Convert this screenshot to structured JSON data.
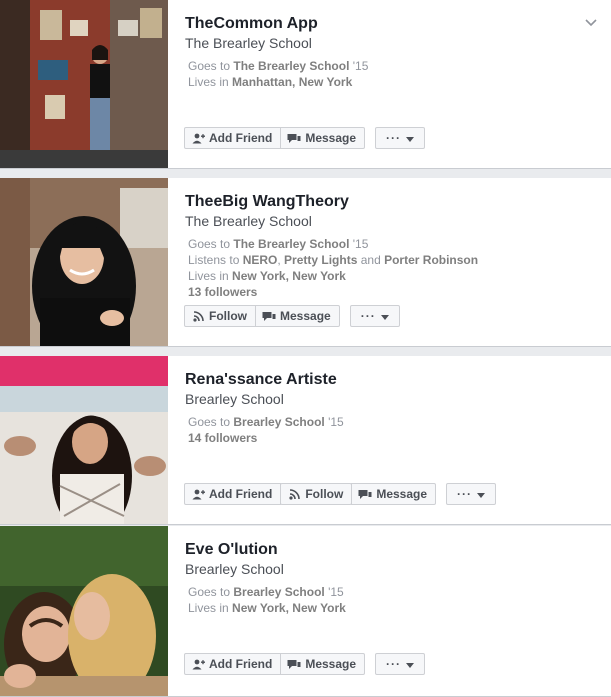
{
  "results": [
    {
      "name": "TheCommon App",
      "school": "The Brearley School",
      "goes_prefix": "Goes to ",
      "goes_school": "The Brearley School",
      "goes_year": " '15",
      "lives_prefix": "Lives in ",
      "lives_place": "Manhattan, New York",
      "add_friend": "Add Friend",
      "message": "Message",
      "more": "···"
    },
    {
      "name": "TheeBig WangTheory",
      "school": "The Brearley School",
      "goes_prefix": "Goes to ",
      "goes_school": "The Brearley School",
      "goes_year": " '15",
      "listens_prefix": "Listens to ",
      "artist1": "NERO",
      "sep1": ", ",
      "artist2": "Pretty Lights",
      "sep2": " and ",
      "artist3": "Porter Robinson",
      "lives_prefix": "Lives in ",
      "lives_place": "New York, New York",
      "followers": "13 followers",
      "follow": "Follow",
      "message": "Message",
      "more": "···"
    },
    {
      "name": "Rena'ssance Artiste",
      "school": "Brearley School",
      "goes_prefix": "Goes to ",
      "goes_school": "Brearley School",
      "goes_year": " '15",
      "followers": "14 followers",
      "add_friend": "Add Friend",
      "follow": "Follow",
      "message": "Message",
      "more": "···"
    },
    {
      "name": "Eve O'lution",
      "school": "Brearley School",
      "goes_prefix": "Goes to ",
      "goes_school": "Brearley School",
      "goes_year": " '15",
      "lives_prefix": "Lives in ",
      "lives_place": "New York, New York",
      "add_friend": "Add Friend",
      "message": "Message",
      "more": "···"
    }
  ],
  "icons": {
    "add_friend": "add-friend-icon",
    "message": "message-icon",
    "follow": "rss-follow-icon",
    "chevron": "chevron-down-icon",
    "dropdown": "caret-down-icon"
  },
  "colors": {
    "name": "#1d2129",
    "detail": "#90949c",
    "button_bg": "#f6f7f9",
    "button_border": "#ced0d4",
    "page_bg": "#e9ebee"
  }
}
